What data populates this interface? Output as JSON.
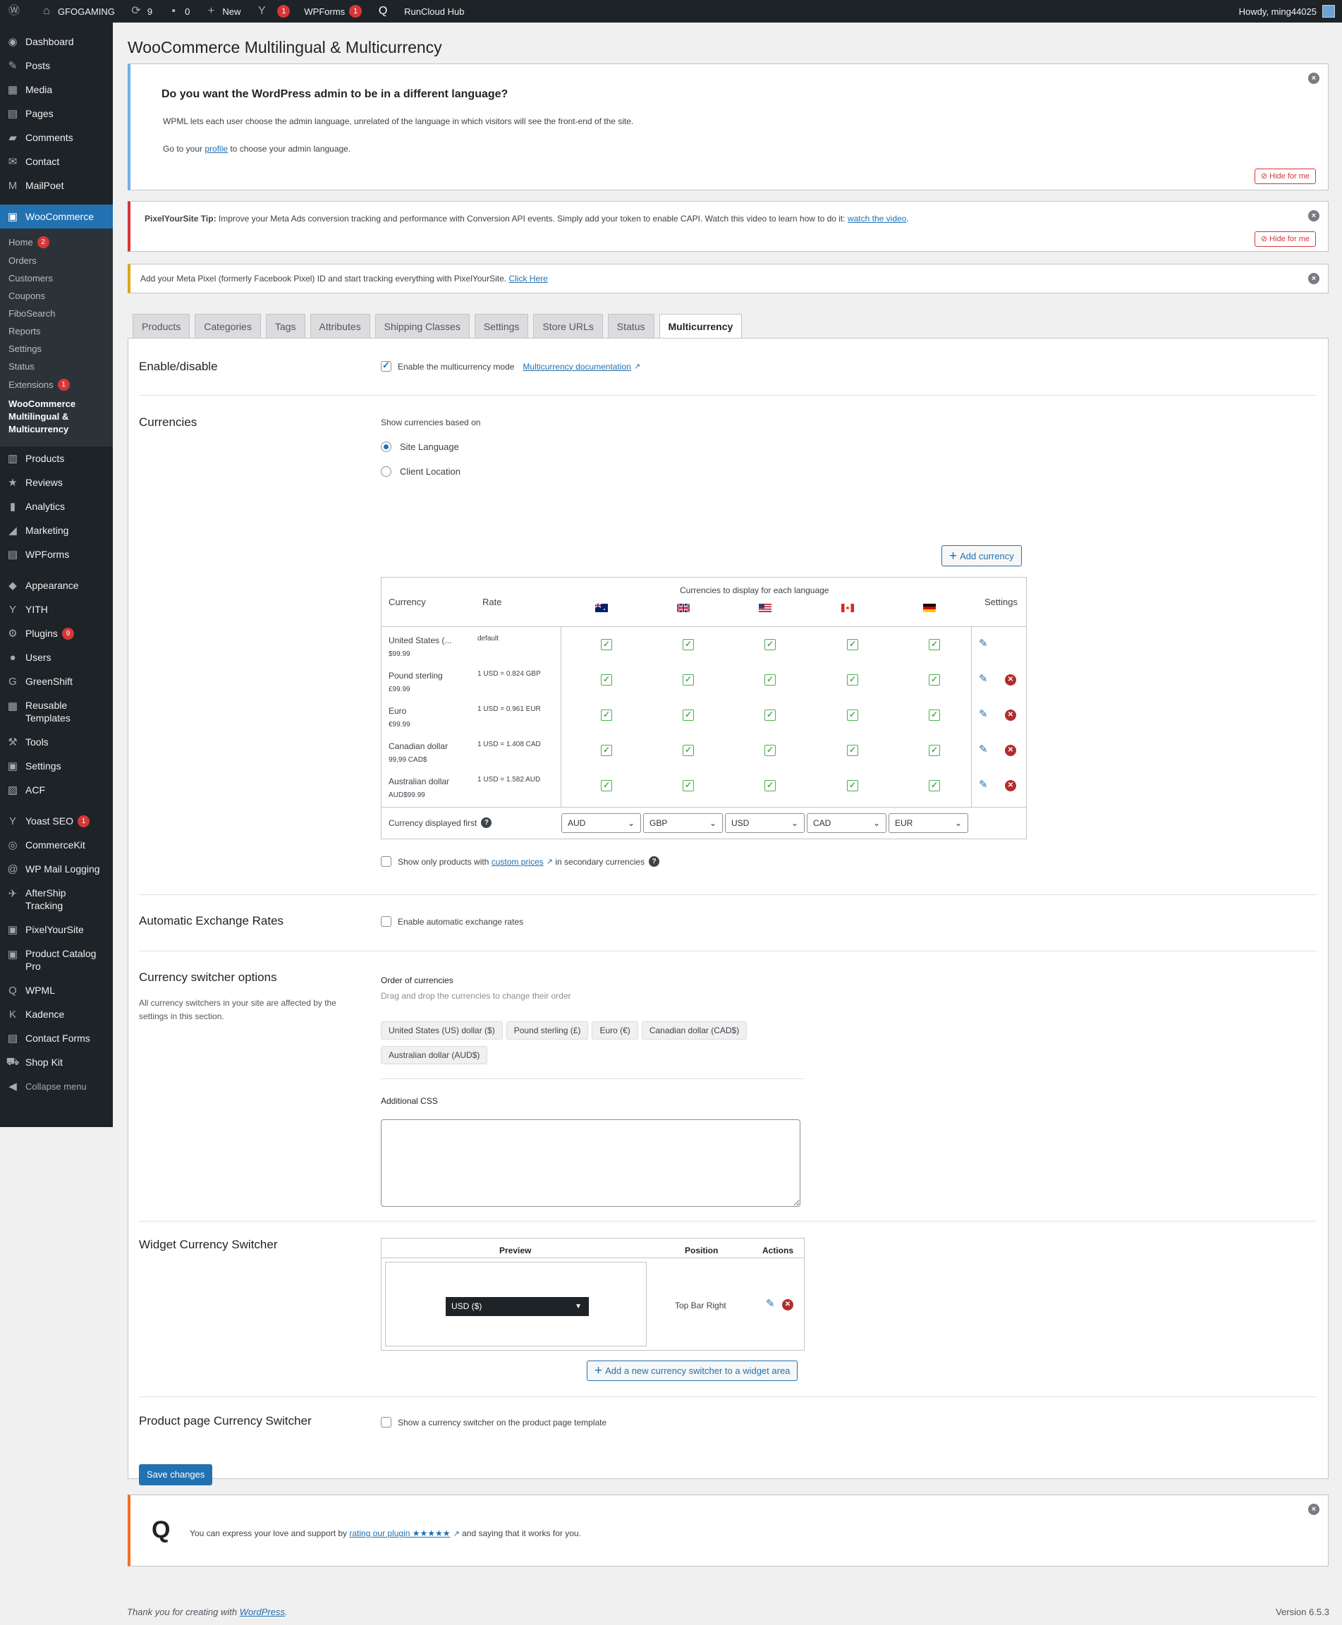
{
  "adminbar": {
    "site_name": "GFOGAMING",
    "updates_count": "9",
    "comments_count": "0",
    "new_label": "New",
    "yoast_badge": "1",
    "wpforms_label": "WPForms",
    "wpforms_badge": "1",
    "runcloud_label": "RunCloud Hub",
    "howdy": "Howdy, ming44025"
  },
  "sidebar": {
    "items_top": [
      {
        "label": "Dashboard",
        "icon": "dashboard-icon"
      },
      {
        "label": "Posts",
        "icon": "pin-icon"
      },
      {
        "label": "Media",
        "icon": "media-icon"
      },
      {
        "label": "Pages",
        "icon": "pages-icon"
      },
      {
        "label": "Comments",
        "icon": "comments-icon"
      },
      {
        "label": "Contact",
        "icon": "mail-icon"
      },
      {
        "label": "MailPoet",
        "icon": "mailpoet-icon"
      }
    ],
    "woocommerce": "WooCommerce",
    "woo_sub": [
      {
        "label": "Home",
        "badge": "2"
      },
      {
        "label": "Orders"
      },
      {
        "label": "Customers"
      },
      {
        "label": "Coupons"
      },
      {
        "label": "FiboSearch"
      },
      {
        "label": "Reports"
      },
      {
        "label": "Settings"
      },
      {
        "label": "Status"
      },
      {
        "label": "Extensions",
        "badge": "1"
      }
    ],
    "woo_current": "WooCommerce Multilingual & Multicurrency",
    "items_mid": [
      {
        "label": "Products"
      },
      {
        "label": "Reviews"
      },
      {
        "label": "Analytics"
      },
      {
        "label": "Marketing"
      },
      {
        "label": "WPForms"
      }
    ],
    "items_low": [
      {
        "label": "Appearance"
      },
      {
        "label": "YITH"
      },
      {
        "label": "Plugins",
        "badge": "9"
      },
      {
        "label": "Users"
      },
      {
        "label": "GreenShift"
      },
      {
        "label": "Reusable Templates"
      },
      {
        "label": "Tools"
      },
      {
        "label": "Settings"
      },
      {
        "label": "ACF"
      }
    ],
    "items_bottom": [
      {
        "label": "Yoast SEO",
        "badge": "1"
      },
      {
        "label": "CommerceKit"
      },
      {
        "label": "WP Mail Logging"
      },
      {
        "label": "AfterShip Tracking"
      },
      {
        "label": "PixelYourSite"
      },
      {
        "label": "Product Catalog Pro"
      },
      {
        "label": "WPML"
      },
      {
        "label": "Kadence"
      },
      {
        "label": "Contact Forms"
      },
      {
        "label": "Shop Kit"
      }
    ],
    "collapse": "Collapse menu"
  },
  "page": {
    "title": "WooCommerce Multilingual & Multicurrency"
  },
  "notice_lang": {
    "heading": "Do you want the WordPress admin to be in a different language?",
    "text": "WPML lets each user choose the admin language, unrelated of the language in which visitors will see the front-end of the site.",
    "goto_pre": "Go to your",
    "goto_link": "profile",
    "goto_post": "to choose your admin language.",
    "hide": "Hide for me"
  },
  "notice_pys": {
    "bold": "PixelYourSite Tip:",
    "text": "Improve your Meta Ads conversion tracking and performance with Conversion API events. Simply add your token to enable CAPI. Watch this video to learn how to do it:",
    "link": "watch the video",
    "hide": "Hide for me"
  },
  "notice_pixel": {
    "text": "Add your Meta Pixel (formerly Facebook Pixel) ID and start tracking everything with PixelYourSite.",
    "link": "Click Here"
  },
  "tabs": [
    "Products",
    "Categories",
    "Tags",
    "Attributes",
    "Shipping Classes",
    "Settings",
    "Store URLs",
    "Status",
    "Multicurrency"
  ],
  "enable": {
    "title": "Enable/disable",
    "label": "Enable the multicurrency mode",
    "doc_link": "Multicurrency documentation"
  },
  "currencies": {
    "title": "Currencies",
    "based_on": "Show currencies based on",
    "opt_site": "Site Language",
    "opt_client": "Client Location",
    "add_btn": "Add currency",
    "col_currency": "Currency",
    "col_rate": "Rate",
    "col_display": "Currencies to display for each language",
    "col_settings": "Settings",
    "rows": [
      {
        "name": "United States (...",
        "sample": "$99.99",
        "rate": "default"
      },
      {
        "name": "Pound sterling",
        "sample": "£99.99",
        "rate": "1 USD = 0.824 GBP"
      },
      {
        "name": "Euro",
        "sample": "€99.99",
        "rate": "1 USD = 0.961 EUR"
      },
      {
        "name": "Canadian dollar",
        "sample": "99,99 CAD$",
        "rate": "1 USD = 1.408 CAD"
      },
      {
        "name": "Australian dollar",
        "sample": "AUD$99.99",
        "rate": "1 USD = 1.582 AUD"
      }
    ],
    "first_label": "Currency displayed first",
    "first_values": [
      "AUD",
      "GBP",
      "USD",
      "CAD",
      "EUR"
    ],
    "custom_pre": "Show only products with",
    "custom_link": "custom prices",
    "custom_post": "in secondary currencies"
  },
  "auto_rates": {
    "title": "Automatic Exchange Rates",
    "label": "Enable automatic exchange rates"
  },
  "switcher": {
    "title": "Currency switcher options",
    "desc": "All currency switchers in your site are affected by the settings in this section.",
    "order_title": "Order of currencies",
    "order_hint": "Drag and drop the currencies to change their order",
    "order": [
      "United States (US) dollar ($)",
      "Pound sterling (£)",
      "Euro (€)",
      "Canadian dollar (CAD$)",
      "Australian dollar (AUD$)"
    ],
    "css_label": "Additional CSS"
  },
  "widget": {
    "title": "Widget Currency Switcher",
    "col_preview": "Preview",
    "col_position": "Position",
    "col_actions": "Actions",
    "preview_value": "USD ($)",
    "position": "Top Bar Right",
    "add_btn": "Add a new currency switcher to a widget area"
  },
  "product_page": {
    "title": "Product page Currency Switcher",
    "label": "Show a currency switcher on the product page template"
  },
  "save": "Save changes",
  "rating": {
    "pre": "You can express your love and support by",
    "link": "rating our plugin ★★★★★",
    "post": "and saying that it works for you."
  },
  "footer": {
    "thanks_pre": "Thank you for creating with",
    "thanks_link": "WordPress",
    "version": "Version 6.5.3"
  }
}
